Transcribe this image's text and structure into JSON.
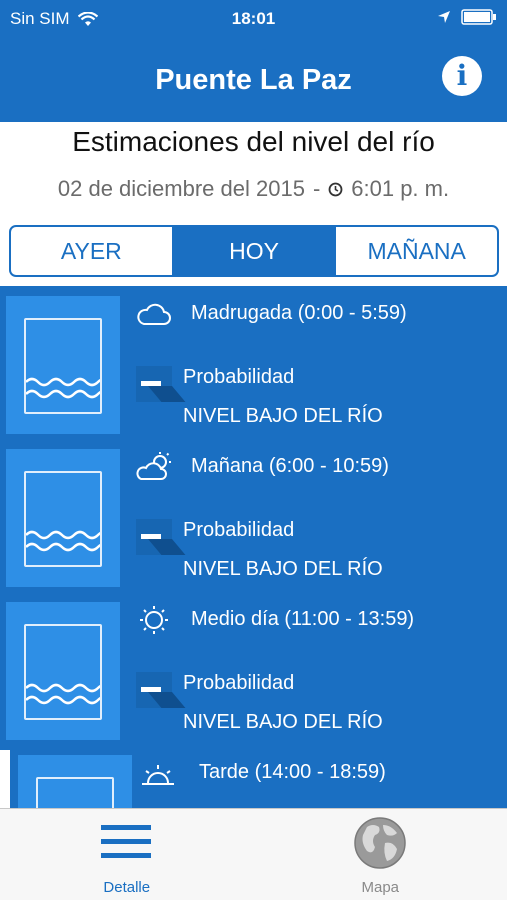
{
  "status_bar": {
    "carrier": "Sin SIM",
    "time": "18:01"
  },
  "navbar": {
    "title": "Puente La Paz",
    "info_glyph": "i"
  },
  "header": {
    "heading": "Estimaciones del nivel del río",
    "date": "02 de diciembre del 2015",
    "separator": "-",
    "time": "6:01 p. m."
  },
  "segments": [
    {
      "label": "AYER",
      "active": false
    },
    {
      "label": "HOY",
      "active": true
    },
    {
      "label": "MAÑANA",
      "active": false
    }
  ],
  "periods": [
    {
      "label": "Madrugada (0:00 - 5:59)",
      "icon": "cloud-icon",
      "prob_label": "Probabilidad",
      "level": "NIVEL BAJO DEL RÍO"
    },
    {
      "label": "Mañana (6:00 - 10:59)",
      "icon": "partly-sunny-icon",
      "prob_label": "Probabilidad",
      "level": "NIVEL BAJO DEL RÍO"
    },
    {
      "label": "Medio día (11:00 - 13:59)",
      "icon": "sun-icon",
      "prob_label": "Probabilidad",
      "level": "NIVEL BAJO DEL RÍO"
    },
    {
      "label": "Tarde (14:00 - 18:59)",
      "icon": "sunset-icon"
    }
  ],
  "tabs": [
    {
      "label": "Detalle",
      "icon": "list-icon",
      "active": true
    },
    {
      "label": "Mapa",
      "icon": "globe-icon",
      "active": false
    }
  ],
  "colors": {
    "primary": "#1a6fc2",
    "tile": "#2e8fe6",
    "tabbar": "#f7f7f7"
  }
}
